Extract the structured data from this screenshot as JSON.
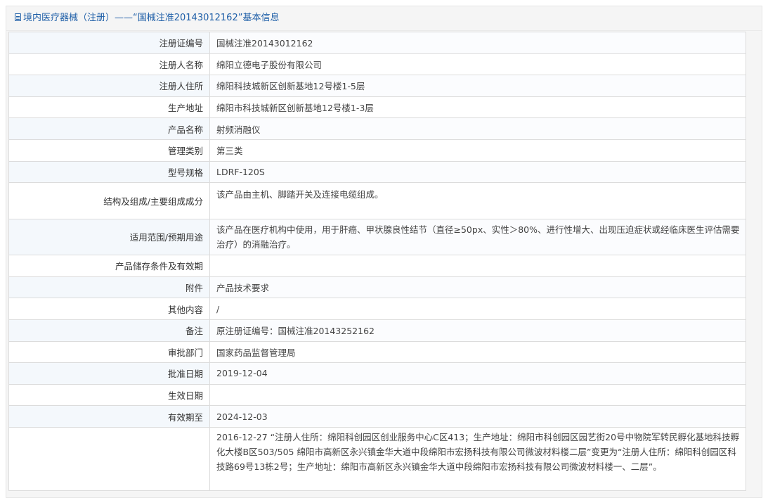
{
  "header": {
    "title": "境内医疗器械（注册）——“国械注准20143012162”基本信息"
  },
  "rows": [
    {
      "label": "注册证编号",
      "value": "国械注准20143012162"
    },
    {
      "label": "注册人名称",
      "value": "绵阳立德电子股份有限公司"
    },
    {
      "label": "注册人住所",
      "value": "绵阳科技城新区创新基地12号楼1-5层"
    },
    {
      "label": "生产地址",
      "value": "绵阳市科技城新区创新基地12号楼1-3层"
    },
    {
      "label": "产品名称",
      "value": "射频消融仪"
    },
    {
      "label": "管理类别",
      "value": "第三类"
    },
    {
      "label": "型号规格",
      "value": "LDRF-120S"
    },
    {
      "label": "结构及组成/主要组成成分",
      "value": "该产品由主机、脚踏开关及连接电缆组成。"
    },
    {
      "label": "适用范围/预期用途",
      "value": "该产品在医疗机构中使用，用于肝癌、甲状腺良性结节（直径≥50px、实性＞80%、进行性增大、出现压迫症状或经临床医生评估需要治疗）的消融治疗。"
    },
    {
      "label": "产品储存条件及有效期",
      "value": ""
    },
    {
      "label": "附件",
      "value": "产品技术要求"
    },
    {
      "label": "其他内容",
      "value": "/"
    },
    {
      "label": "备注",
      "value": "原注册证编号：国械注准20143252162"
    },
    {
      "label": "审批部门",
      "value": "国家药品监督管理局"
    },
    {
      "label": "批准日期",
      "value": "2019-12-04"
    },
    {
      "label": "生效日期",
      "value": ""
    },
    {
      "label": "有效期至",
      "value": "2024-12-03"
    },
    {
      "label": "",
      "value": "2016-12-27 “注册人住所：绵阳科创园区创业服务中心C区413；生产地址：绵阳市科创园区园艺街20号中物院军转民孵化基地科技孵化大楼B区503/505 绵阳市高新区永兴镇金华大道中段绵阳市宏扬科技有限公司微波材料楼二层”变更为“注册人住所：绵阳科创园区科技路69号13栋2号；生产地址：绵阳市高新区永兴镇金华大道中段绵阳市宏扬科技有限公司微波材料楼一、二层”。"
    }
  ]
}
